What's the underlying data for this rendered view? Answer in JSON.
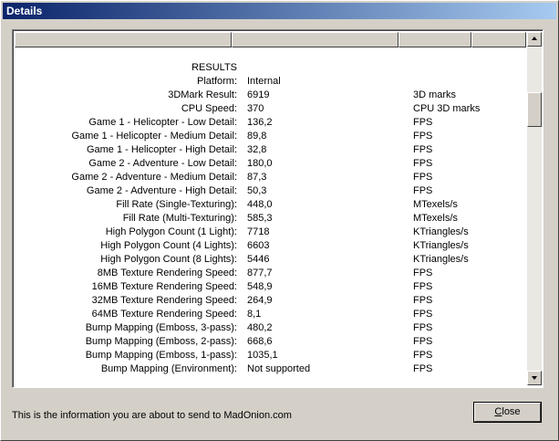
{
  "window": {
    "title": "Details"
  },
  "rows": [
    {
      "label": "RESULTS",
      "value": "",
      "unit": ""
    },
    {
      "label": "Platform:",
      "value": "Internal",
      "unit": ""
    },
    {
      "label": "3DMark Result:",
      "value": "6919",
      "unit": "3D marks"
    },
    {
      "label": "CPU Speed:",
      "value": "370",
      "unit": "CPU 3D marks"
    },
    {
      "label": "Game 1 - Helicopter - Low Detail:",
      "value": "136,2",
      "unit": "FPS"
    },
    {
      "label": "Game 1 - Helicopter - Medium Detail:",
      "value": "89,8",
      "unit": "FPS"
    },
    {
      "label": "Game 1 - Helicopter - High Detail:",
      "value": "32,8",
      "unit": "FPS"
    },
    {
      "label": "Game 2 - Adventure - Low Detail:",
      "value": "180,0",
      "unit": "FPS"
    },
    {
      "label": "Game 2 - Adventure - Medium Detail:",
      "value": "87,3",
      "unit": "FPS"
    },
    {
      "label": "Game 2 - Adventure - High Detail:",
      "value": "50,3",
      "unit": "FPS"
    },
    {
      "label": "Fill Rate (Single-Texturing):",
      "value": "448,0",
      "unit": "MTexels/s"
    },
    {
      "label": "Fill Rate (Multi-Texturing):",
      "value": "585,3",
      "unit": "MTexels/s"
    },
    {
      "label": "High Polygon Count (1 Light):",
      "value": "7718",
      "unit": "KTriangles/s"
    },
    {
      "label": "High Polygon Count (4 Lights):",
      "value": "6603",
      "unit": "KTriangles/s"
    },
    {
      "label": "High Polygon Count (8 Lights):",
      "value": "5446",
      "unit": "KTriangles/s"
    },
    {
      "label": "8MB Texture Rendering Speed:",
      "value": "877,7",
      "unit": "FPS"
    },
    {
      "label": "16MB Texture Rendering Speed:",
      "value": "548,9",
      "unit": "FPS"
    },
    {
      "label": "32MB Texture Rendering Speed:",
      "value": "264,9",
      "unit": "FPS"
    },
    {
      "label": "64MB Texture Rendering Speed:",
      "value": "8,1",
      "unit": "FPS"
    },
    {
      "label": "Bump Mapping (Emboss, 3-pass):",
      "value": "480,2",
      "unit": "FPS"
    },
    {
      "label": "Bump Mapping (Emboss, 2-pass):",
      "value": "668,6",
      "unit": "FPS"
    },
    {
      "label": "Bump Mapping (Emboss, 1-pass):",
      "value": "1035,1",
      "unit": "FPS"
    },
    {
      "label": "Bump Mapping (Environment):",
      "value": "Not supported",
      "unit": "FPS"
    }
  ],
  "footer": {
    "info_text": "This is the information you are about to send to MadOnion.com",
    "close_label_mnemonic": "C",
    "close_label_rest": "lose"
  },
  "icons": {
    "scroll_up": "scroll-up-arrow-icon",
    "scroll_down": "scroll-down-arrow-icon"
  },
  "colors": {
    "titlebar_start": "#0a246a",
    "titlebar_end": "#a6caf0",
    "face": "#d4d0c8"
  }
}
